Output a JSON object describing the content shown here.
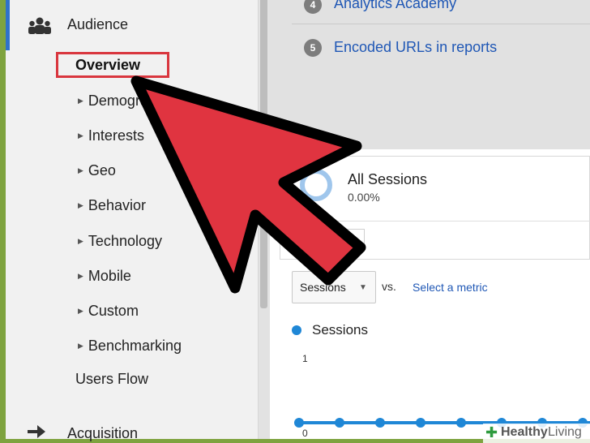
{
  "sidebar": {
    "audience_label": "Audience",
    "overview_label": "Overview",
    "items": [
      {
        "label": "Demographics"
      },
      {
        "label": "Interests"
      },
      {
        "label": "Geo"
      },
      {
        "label": "Behavior"
      },
      {
        "label": "Technology"
      },
      {
        "label": "Mobile"
      },
      {
        "label": "Custom"
      },
      {
        "label": "Benchmarking"
      }
    ],
    "users_flow_label": "Users Flow",
    "acquisition_label": "Acquisition"
  },
  "help_links": [
    {
      "number": "4",
      "label": "Analytics Academy"
    },
    {
      "number": "5",
      "label": "Encoded URLs in reports"
    }
  ],
  "segment": {
    "title": "All Sessions",
    "value": "0.00%"
  },
  "metric_picker": {
    "selected": "Sessions",
    "vs_label": "vs.",
    "select_metric_label": "Select a metric"
  },
  "chart": {
    "legend_label": "Sessions",
    "y_max_label": "1",
    "y_min_label": "0",
    "series_color": "#1f87d6"
  },
  "watermark": {
    "word1": "Healthy",
    "word2": "Living"
  },
  "colors": {
    "frame": "#7ea33f",
    "highlight_box": "#d9363e",
    "arrow_fill": "#e03440",
    "link": "#1f57b5"
  }
}
